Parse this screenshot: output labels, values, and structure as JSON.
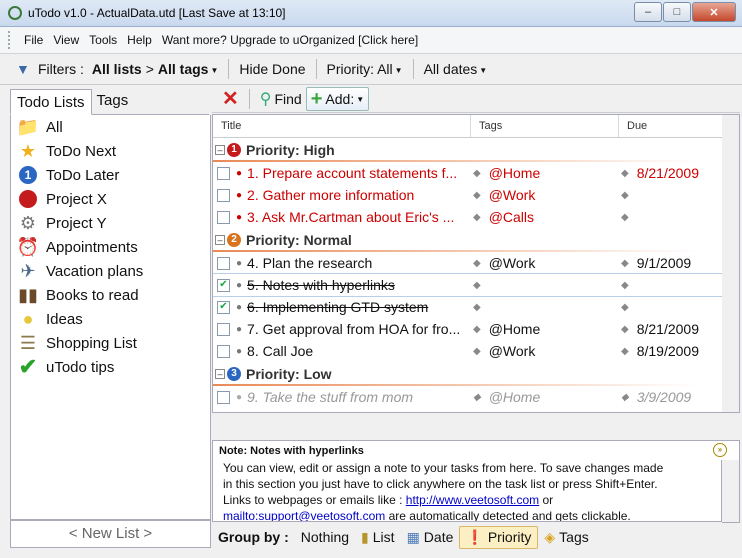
{
  "window": {
    "title": "uTodo v1.0 - ActualData.utd   [Last Save at 13:10]"
  },
  "menu": {
    "items": [
      "File",
      "View",
      "Tools",
      "Help",
      "Want more? Upgrade to uOrganized [Click here]"
    ]
  },
  "filterbar": {
    "label": "Filters :",
    "lists": "All lists",
    "gt": ">",
    "tags": "All tags",
    "hide_done": "Hide Done",
    "priority": "Priority: All",
    "dates": "All dates"
  },
  "left": {
    "tabs": [
      "Todo Lists",
      "Tags"
    ],
    "items": [
      {
        "label": "All",
        "icon": "folder-icon",
        "color": "#e3c157"
      },
      {
        "label": "ToDo Next",
        "icon": "star-icon",
        "color": "#f0b21c"
      },
      {
        "label": "ToDo Later",
        "icon": "number-one-icon",
        "color": "#2a66c2"
      },
      {
        "label": "Project X",
        "icon": "red-circle-icon",
        "color": "#c41c1c"
      },
      {
        "label": "Project Y",
        "icon": "gears-icon",
        "color": "#777777"
      },
      {
        "label": "Appointments",
        "icon": "clock-icon",
        "color": "#666666"
      },
      {
        "label": "Vacation plans",
        "icon": "airplane-icon",
        "color": "#4a6a8a"
      },
      {
        "label": "Books to read",
        "icon": "books-icon",
        "color": "#6a4a2a"
      },
      {
        "label": "Ideas",
        "icon": "lightbulb-icon",
        "color": "#e6c93a"
      },
      {
        "label": "Shopping List",
        "icon": "notepad-icon",
        "color": "#8a7a4a"
      },
      {
        "label": "uTodo tips",
        "icon": "checkmark-icon",
        "color": "#2aa32a"
      }
    ],
    "new_list": "< New List >"
  },
  "toolbar": {
    "find": "Find",
    "add": "Add:"
  },
  "grid": {
    "columns": [
      "Title",
      "Tags",
      "Due"
    ],
    "groups": [
      {
        "label": "Priority: High",
        "badge": "1",
        "badge_color": "#c41c1c",
        "rows": [
          {
            "title": "1. Prepare account statements f...",
            "tag": "@Home",
            "due": "8/21/2009",
            "done": false,
            "style": "red"
          },
          {
            "title": "2. Gather more information",
            "tag": "@Work",
            "due": "",
            "done": false,
            "style": "red"
          },
          {
            "title": "3. Ask Mr.Cartman about Eric's ...",
            "tag": "@Calls",
            "due": "",
            "done": false,
            "style": "red"
          }
        ]
      },
      {
        "label": "Priority: Normal",
        "badge": "2",
        "badge_color": "#d9731e",
        "rows": [
          {
            "title": "4. Plan the research",
            "tag": "@Work",
            "due": "9/1/2009",
            "done": false,
            "style": "normal"
          },
          {
            "title": "5. Notes with hyperlinks",
            "tag": "",
            "due": "",
            "done": true,
            "style": "strike"
          },
          {
            "title": "6. Implementing GTD system",
            "tag": "",
            "due": "",
            "done": true,
            "style": "strike"
          },
          {
            "title": "7. Get approval from HOA for fro...",
            "tag": "@Home",
            "due": "8/21/2009",
            "done": false,
            "style": "normal"
          },
          {
            "title": "8. Call Joe",
            "tag": "@Work",
            "due": "8/19/2009",
            "done": false,
            "style": "normal"
          }
        ]
      },
      {
        "label": "Priority: Low",
        "badge": "3",
        "badge_color": "#2a66c2",
        "rows": [
          {
            "title": "9. Take the stuff from mom",
            "tag": "@Home",
            "due": "3/9/2009",
            "done": false,
            "style": "gray"
          }
        ]
      }
    ]
  },
  "note": {
    "header": "Note: Notes with hyperlinks",
    "line1": "You can view, edit or assign a note to your tasks from here. To save changes made",
    "line2": "in this section you just have to click anywhere on the task list or press Shift+Enter.",
    "line3_pre": "Links to webpages or emails like : ",
    "link1": "http://www.veetosoft.com",
    "line3_post": " or",
    "link2": "mailto:support@veetosoft.com",
    "line4_post": " are automatically detected and gets clickable."
  },
  "groupby": {
    "label": "Group by :",
    "options": [
      {
        "label": "Nothing",
        "icon": "",
        "active": false
      },
      {
        "label": "List",
        "icon": "list-icon",
        "active": false
      },
      {
        "label": "Date",
        "icon": "calendar-icon",
        "active": false
      },
      {
        "label": "Priority",
        "icon": "priority-icon",
        "active": true
      },
      {
        "label": "Tags",
        "icon": "tags-icon",
        "active": false
      }
    ]
  }
}
